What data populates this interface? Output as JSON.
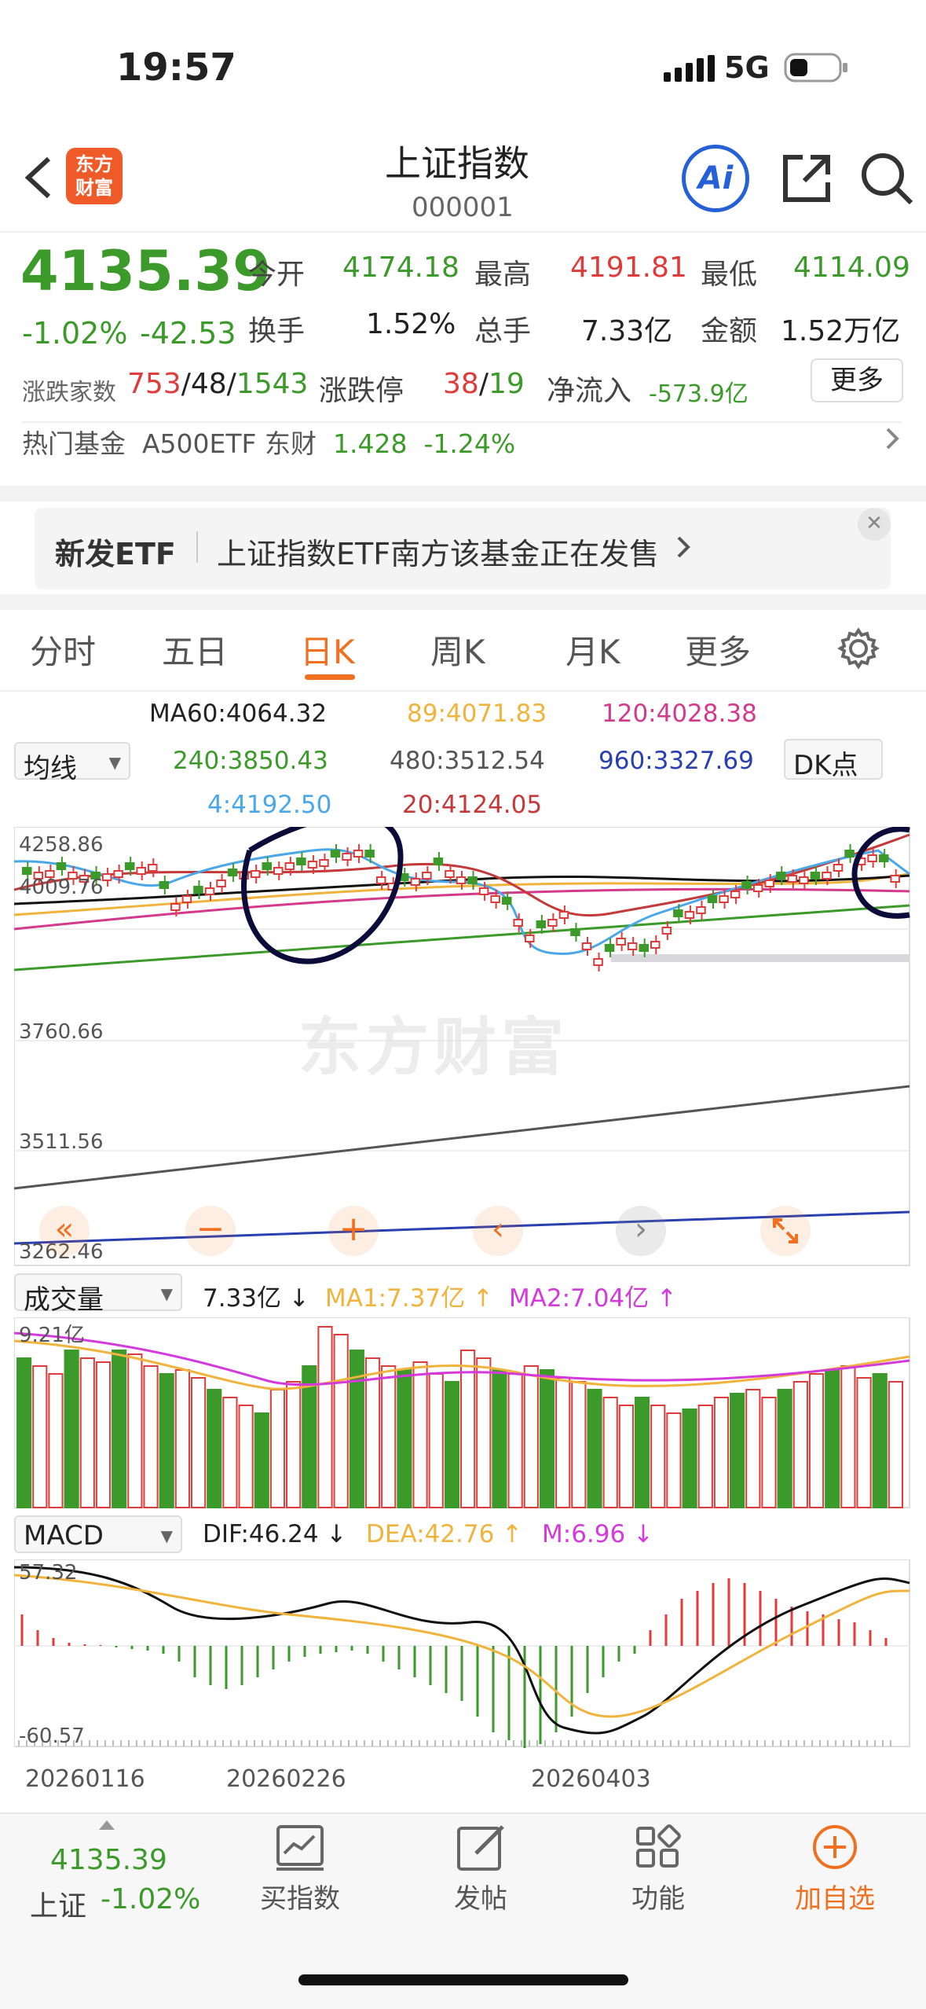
{
  "status": {
    "time": "19:57",
    "network": "5G"
  },
  "nav": {
    "title": "上证指数",
    "code": "000001",
    "logo_line1": "东方",
    "logo_line2": "财富",
    "ai_label": "Ai"
  },
  "quote": {
    "price": "4135.39",
    "change_pct": "-1.02%",
    "change": "-42.53",
    "open_label": "今开",
    "open": "4174.18",
    "high_label": "最高",
    "high": "4191.81",
    "low_label": "最低",
    "low": "4114.09",
    "turnover_label": "换手",
    "turnover": "1.52%",
    "volume_label": "总手",
    "volume": "7.33亿",
    "amount_label": "金额",
    "amount": "1.52万亿",
    "breadth_label": "涨跌家数",
    "up": "753",
    "flat": "48",
    "down": "1543",
    "limit_label": "涨跌停",
    "limit_up": "38",
    "limit_down": "19",
    "inflow_label": "净流入",
    "inflow": "-573.9亿",
    "more": "更多"
  },
  "hot_fund": {
    "label": "热门基金",
    "name": "A500ETF 东财",
    "price": "1.428",
    "pct": "-1.24%"
  },
  "banner": {
    "tag": "新发ETF",
    "text": "上证指数ETF南方该基金正在发售"
  },
  "tabs": [
    "分时",
    "五日",
    "日K",
    "周K",
    "月K",
    "更多"
  ],
  "active_tab": "日K",
  "ma": {
    "ma60": "MA60:4064.32",
    "ma89": "89:4071.83",
    "ma120": "120:4028.38",
    "ma240": "240:3850.43",
    "ma480": "480:3512.54",
    "ma960": "960:3327.69",
    "ma4": "4:4192.50",
    "ma20": "20:4124.05",
    "selector": "均线",
    "dk": "DK点"
  },
  "price_axis": [
    "4258.86",
    "4009.76",
    "3760.66",
    "3511.56",
    "3262.46"
  ],
  "volume": {
    "selector": "成交量",
    "total": "7.33亿",
    "ma1": "MA1:7.37亿",
    "ma2": "MA2:7.04亿",
    "top": "9.21亿"
  },
  "macd": {
    "selector": "MACD",
    "dif": "DIF:46.24",
    "dea": "DEA:42.76",
    "m": "M:6.96",
    "top": "57.32",
    "bottom": "-60.57"
  },
  "dates": [
    "20260116",
    "20260226",
    "20260403"
  ],
  "bottom": {
    "price": "4135.39",
    "name": "上证",
    "pct": "-1.02%",
    "buy": "买指数",
    "post": "发帖",
    "func": "功能",
    "add": "加自选"
  },
  "watermark": "东方财富",
  "colors": {
    "up": "#e03b3b",
    "down": "#3c9a2a",
    "accent": "#f07020"
  }
}
